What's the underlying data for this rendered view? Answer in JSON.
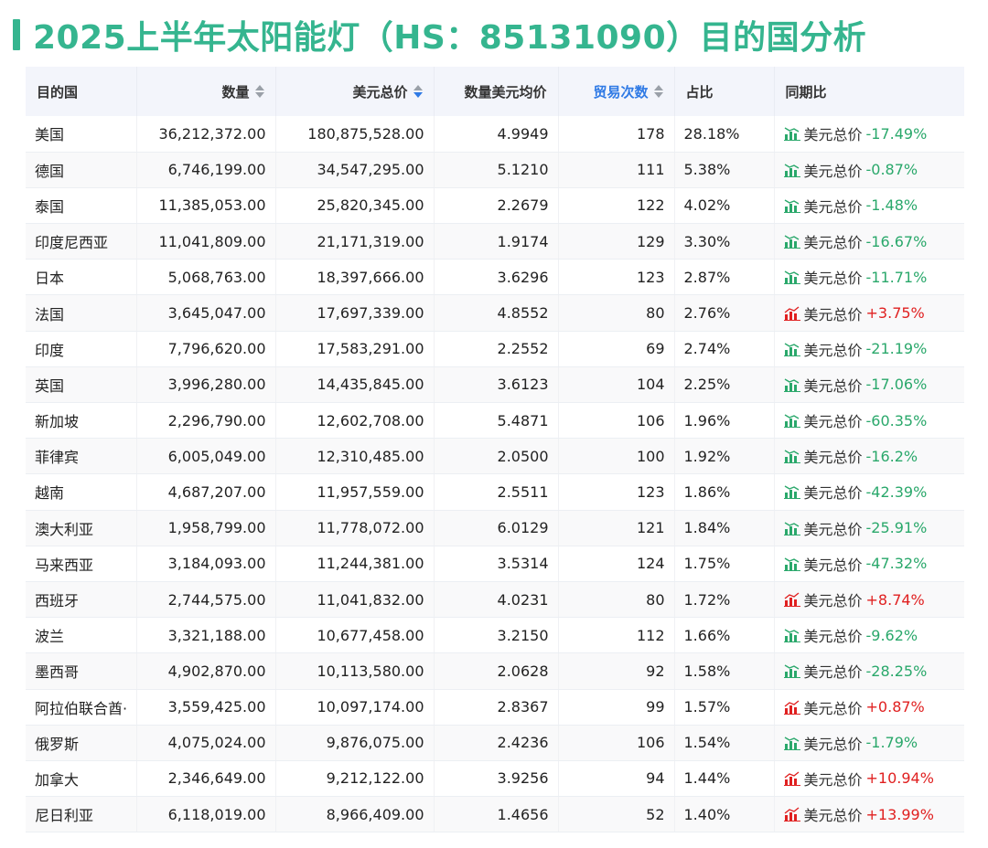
{
  "title": "2025上半年太阳能灯（HS：85131090）目的国分析",
  "colors": {
    "accent": "#35b58f",
    "title": "#35b58f",
    "down": "#2aa86b",
    "up": "#e02020",
    "header_bg": "#f3f5fb",
    "sort_active": "#2f7ae5"
  },
  "table": {
    "headers": {
      "country": "目的国",
      "quantity": "数量",
      "usd_total": "美元总价",
      "unit_price": "数量美元均价",
      "trade_count": "贸易次数",
      "share": "占比",
      "yoy": "同期比"
    },
    "sort_state": {
      "quantity": "none",
      "usd_total": "descending",
      "trade_count": "none"
    },
    "yoy_label": "美元总价",
    "rows": [
      {
        "country": "美国",
        "quantity": "36,212,372.00",
        "usd_total": "180,875,528.00",
        "unit_price": "4.9949",
        "trade_count": "178",
        "share": "28.18%",
        "yoy": "-17.49%",
        "trend": "down"
      },
      {
        "country": "德国",
        "quantity": "6,746,199.00",
        "usd_total": "34,547,295.00",
        "unit_price": "5.1210",
        "trade_count": "111",
        "share": "5.38%",
        "yoy": "-0.87%",
        "trend": "down"
      },
      {
        "country": "泰国",
        "quantity": "11,385,053.00",
        "usd_total": "25,820,345.00",
        "unit_price": "2.2679",
        "trade_count": "122",
        "share": "4.02%",
        "yoy": "-1.48%",
        "trend": "down"
      },
      {
        "country": "印度尼西亚",
        "quantity": "11,041,809.00",
        "usd_total": "21,171,319.00",
        "unit_price": "1.9174",
        "trade_count": "129",
        "share": "3.30%",
        "yoy": "-16.67%",
        "trend": "down"
      },
      {
        "country": "日本",
        "quantity": "5,068,763.00",
        "usd_total": "18,397,666.00",
        "unit_price": "3.6296",
        "trade_count": "123",
        "share": "2.87%",
        "yoy": "-11.71%",
        "trend": "down"
      },
      {
        "country": "法国",
        "quantity": "3,645,047.00",
        "usd_total": "17,697,339.00",
        "unit_price": "4.8552",
        "trade_count": "80",
        "share": "2.76%",
        "yoy": "+3.75%",
        "trend": "up"
      },
      {
        "country": "印度",
        "quantity": "7,796,620.00",
        "usd_total": "17,583,291.00",
        "unit_price": "2.2552",
        "trade_count": "69",
        "share": "2.74%",
        "yoy": "-21.19%",
        "trend": "down"
      },
      {
        "country": "英国",
        "quantity": "3,996,280.00",
        "usd_total": "14,435,845.00",
        "unit_price": "3.6123",
        "trade_count": "104",
        "share": "2.25%",
        "yoy": "-17.06%",
        "trend": "down"
      },
      {
        "country": "新加坡",
        "quantity": "2,296,790.00",
        "usd_total": "12,602,708.00",
        "unit_price": "5.4871",
        "trade_count": "106",
        "share": "1.96%",
        "yoy": "-60.35%",
        "trend": "down"
      },
      {
        "country": "菲律宾",
        "quantity": "6,005,049.00",
        "usd_total": "12,310,485.00",
        "unit_price": "2.0500",
        "trade_count": "100",
        "share": "1.92%",
        "yoy": "-16.2%",
        "trend": "down"
      },
      {
        "country": "越南",
        "quantity": "4,687,207.00",
        "usd_total": "11,957,559.00",
        "unit_price": "2.5511",
        "trade_count": "123",
        "share": "1.86%",
        "yoy": "-42.39%",
        "trend": "down"
      },
      {
        "country": "澳大利亚",
        "quantity": "1,958,799.00",
        "usd_total": "11,778,072.00",
        "unit_price": "6.0129",
        "trade_count": "121",
        "share": "1.84%",
        "yoy": "-25.91%",
        "trend": "down"
      },
      {
        "country": "马来西亚",
        "quantity": "3,184,093.00",
        "usd_total": "11,244,381.00",
        "unit_price": "3.5314",
        "trade_count": "124",
        "share": "1.75%",
        "yoy": "-47.32%",
        "trend": "down"
      },
      {
        "country": "西班牙",
        "quantity": "2,744,575.00",
        "usd_total": "11,041,832.00",
        "unit_price": "4.0231",
        "trade_count": "80",
        "share": "1.72%",
        "yoy": "+8.74%",
        "trend": "up"
      },
      {
        "country": "波兰",
        "quantity": "3,321,188.00",
        "usd_total": "10,677,458.00",
        "unit_price": "3.2150",
        "trade_count": "112",
        "share": "1.66%",
        "yoy": "-9.62%",
        "trend": "down"
      },
      {
        "country": "墨西哥",
        "quantity": "4,902,870.00",
        "usd_total": "10,113,580.00",
        "unit_price": "2.0628",
        "trade_count": "92",
        "share": "1.58%",
        "yoy": "-28.25%",
        "trend": "down"
      },
      {
        "country": "阿拉伯联合酋·",
        "quantity": "3,559,425.00",
        "usd_total": "10,097,174.00",
        "unit_price": "2.8367",
        "trade_count": "99",
        "share": "1.57%",
        "yoy": "+0.87%",
        "trend": "up"
      },
      {
        "country": "俄罗斯",
        "quantity": "4,075,024.00",
        "usd_total": "9,876,075.00",
        "unit_price": "2.4236",
        "trade_count": "106",
        "share": "1.54%",
        "yoy": "-1.79%",
        "trend": "down"
      },
      {
        "country": "加拿大",
        "quantity": "2,346,649.00",
        "usd_total": "9,212,122.00",
        "unit_price": "3.9256",
        "trade_count": "94",
        "share": "1.44%",
        "yoy": "+10.94%",
        "trend": "up"
      },
      {
        "country": "尼日利亚",
        "quantity": "6,118,019.00",
        "usd_total": "8,966,409.00",
        "unit_price": "1.4656",
        "trade_count": "52",
        "share": "1.40%",
        "yoy": "+13.99%",
        "trend": "up"
      }
    ]
  }
}
